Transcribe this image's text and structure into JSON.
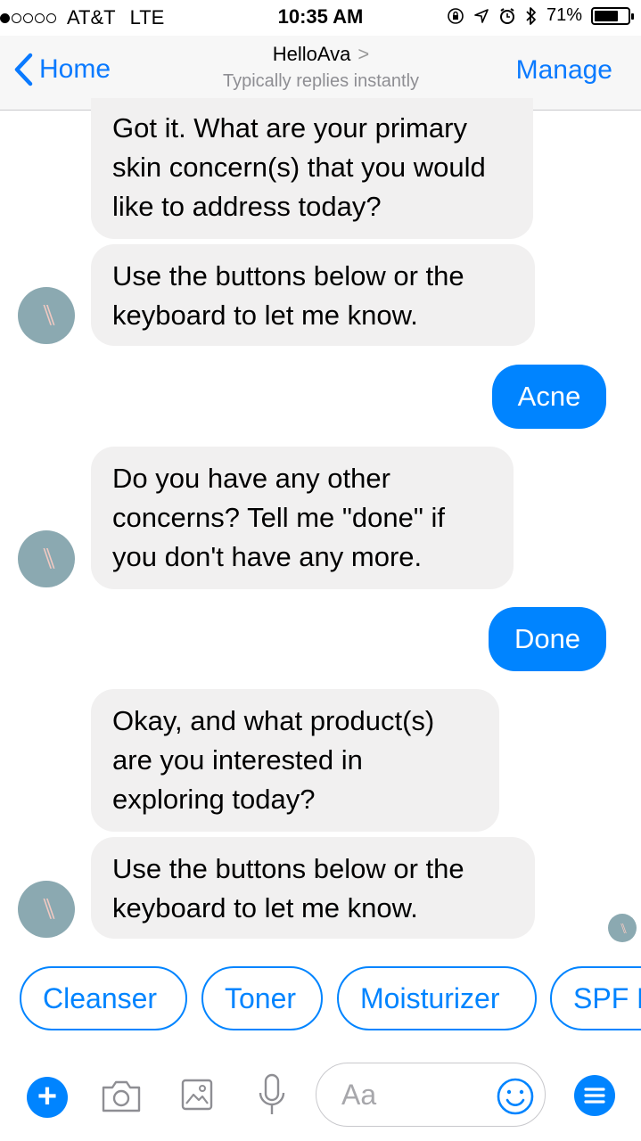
{
  "status_bar": {
    "carrier": "AT&T",
    "network": "LTE",
    "time": "10:35 AM",
    "battery_percent": "71%",
    "battery_level": 0.71,
    "signal_bars_filled": 1,
    "signal_bars_total": 5
  },
  "nav": {
    "back_label": "Home",
    "title": "HelloAva",
    "title_chevron": ">",
    "subtitle": "Typically replies instantly",
    "manage_label": "Manage"
  },
  "messages": [
    {
      "sender": "bot",
      "text": "Got it. What are your primary skin concern(s) that you would like to address today?"
    },
    {
      "sender": "bot",
      "text": "Use the buttons below or the keyboard to let me know."
    },
    {
      "sender": "user",
      "text": "Acne"
    },
    {
      "sender": "bot",
      "text": "Do you have any other concerns? Tell me \"done\" if you don't have any more."
    },
    {
      "sender": "user",
      "text": "Done"
    },
    {
      "sender": "bot",
      "text": "Okay, and what product(s) are you interested in exploring today?"
    },
    {
      "sender": "bot",
      "text": "Use the buttons below or the keyboard to let me know."
    }
  ],
  "avatar": {
    "mark": "\\\\",
    "bg_color": "#8ba9b1",
    "mark_color": "#f1c9c2"
  },
  "quick_replies": [
    "Cleanser",
    "Toner",
    "Moisturizer",
    "SPF M"
  ],
  "composer": {
    "placeholder": "Aa",
    "icons": [
      "plus-icon",
      "camera-icon",
      "photo-icon",
      "microphone-icon",
      "emoji-icon",
      "menu-icon"
    ]
  },
  "colors": {
    "accent": "#0084ff",
    "ios_blue": "#0a7aff",
    "bot_bubble": "#f1f0f0",
    "user_bubble": "#0084ff"
  }
}
